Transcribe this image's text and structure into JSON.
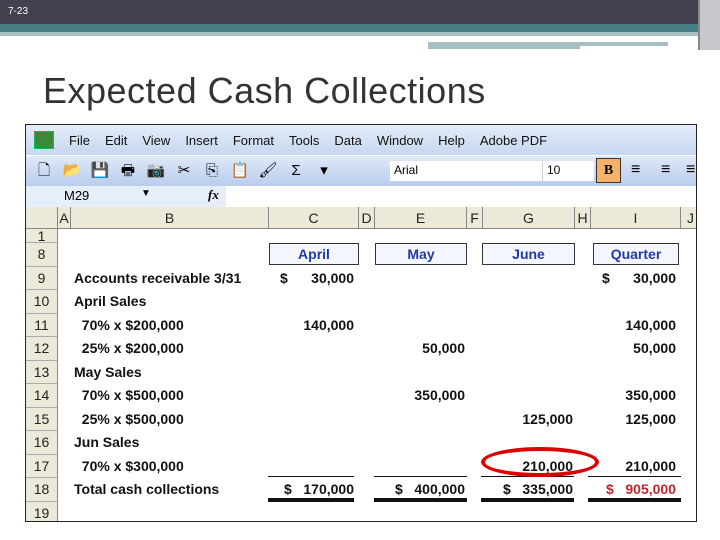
{
  "slide": {
    "number": "7-23",
    "title": "Expected Cash Collections"
  },
  "excel": {
    "menu": [
      "File",
      "Edit",
      "View",
      "Insert",
      "Format",
      "Tools",
      "Data",
      "Window",
      "Help",
      "Adobe PDF"
    ],
    "font": "Arial",
    "font_size": "10",
    "bold_label": "B",
    "name_box": "M29",
    "fx": "fx",
    "columns": [
      "A",
      "B",
      "C",
      "D",
      "E",
      "F",
      "G",
      "H",
      "I",
      "J"
    ],
    "rows": [
      "1",
      "8",
      "9",
      "10",
      "11",
      "12",
      "13",
      "14",
      "15",
      "16",
      "17",
      "18",
      "19"
    ],
    "headers": {
      "april": "April",
      "may": "May",
      "june": "June",
      "quarter": "Quarter"
    },
    "lines": [
      {
        "label": "Accounts receivable 3/31",
        "april": "$      30,000",
        "may": "",
        "june": "",
        "quarter": "$      30,000"
      },
      {
        "label": "April Sales",
        "april": "",
        "may": "",
        "june": "",
        "quarter": ""
      },
      {
        "label": "  70% x $200,000",
        "april": "140,000",
        "may": "",
        "june": "",
        "quarter": "140,000"
      },
      {
        "label": "  25% x $200,000",
        "april": "",
        "may": "50,000",
        "june": "",
        "quarter": "50,000"
      },
      {
        "label": "May Sales",
        "april": "",
        "may": "",
        "june": "",
        "quarter": ""
      },
      {
        "label": "  70% x $500,000",
        "april": "",
        "may": "350,000",
        "june": "",
        "quarter": "350,000"
      },
      {
        "label": "  25% x $500,000",
        "april": "",
        "may": "",
        "june": "125,000",
        "quarter": "125,000"
      },
      {
        "label": "Jun Sales",
        "april": "",
        "may": "",
        "june": "",
        "quarter": ""
      },
      {
        "label": "  70% x $300,000",
        "april": "",
        "may": "",
        "june": "210,000",
        "quarter": "210,000"
      },
      {
        "label": "Total cash collections",
        "april": "$   170,000",
        "may": "$   400,000",
        "june": "$   335,000",
        "quarter": "$   905,000"
      }
    ],
    "highlight_color": "#d00000"
  }
}
